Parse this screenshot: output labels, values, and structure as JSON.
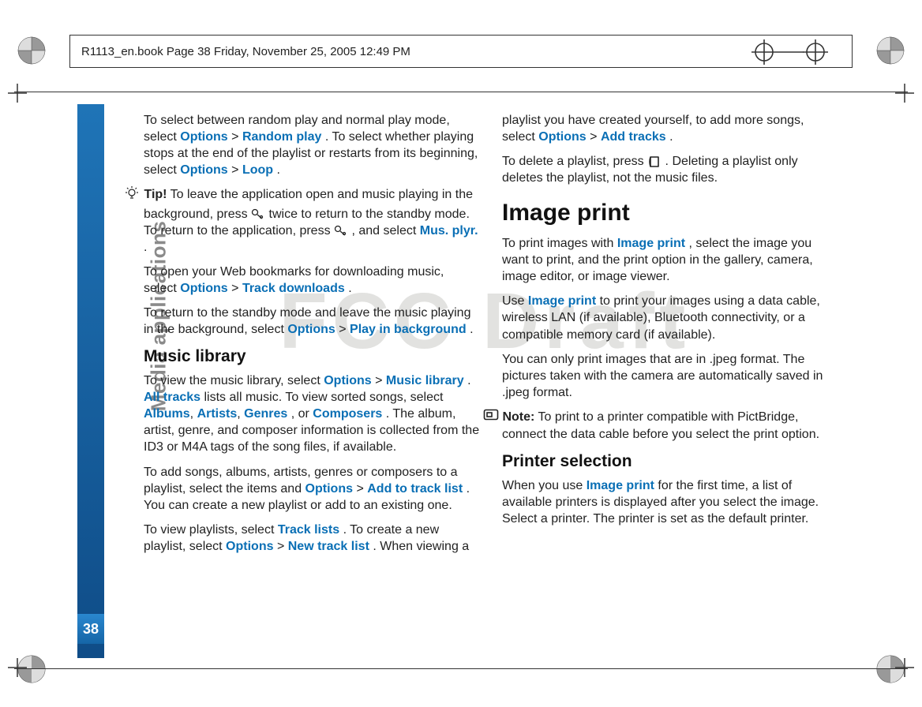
{
  "runningHead": "R1113_en.book  Page 38  Friday, November 25, 2005  12:49 PM",
  "sidebarTitle": "Media applications",
  "pageNumber": "38",
  "watermark": "FCC Draft",
  "col1": {
    "p1a": "To select between random play and normal play mode, select ",
    "opt": "Options",
    "gt": " > ",
    "p1b": "Random play",
    "p1c": ". To select whether playing stops at the end of the playlist or restarts from its beginning, select ",
    "p1d": "Loop",
    "p1e": ".",
    "tipLabel": "Tip!",
    "tipText1": " To leave the application open and music playing in the background, press ",
    "tipText2": " twice to return to the standby mode. To return to the application, press ",
    "tipText3": ", and select ",
    "tipMus": "Mus. plyr.",
    "tipText4": ".",
    "p2a": "To open your Web bookmarks for downloading music, select ",
    "p2b": "Track downloads",
    "p2c": ".",
    "p3a": "To return to the standby mode and leave the music playing in the background, select ",
    "p3b": "Play in background",
    "p3c": ".",
    "h3": "Music library",
    "p4a": "To view the music library, select ",
    "p4b": "Music library",
    "p4c": ". ",
    "allTracks": "All tracks",
    "p4d": " lists all music. To view sorted songs, select ",
    "albums": "Albums",
    "artists": "Artists",
    "genres": "Genres",
    "orWord": ", or ",
    "composers": "Composers",
    "p4e": ". The album, artist, genre, and composer information is collected from the ID3 or M4A tags of the song files, if available.",
    "p5a": "To add songs, albums, artists, genres or composers to a playlist, select the items and ",
    "p5b": "Add to track list",
    "p5c": ". You can create a new playlist or add to an existing one.",
    "p6a": "To view playlists, select ",
    "tracklists": "Track lists",
    "p6b": ". To create a new playlist, select ",
    "p6c": "New track list",
    "p6d": ". When viewing a"
  },
  "col2": {
    "p1a": "playlist you have created yourself, to add more songs, select ",
    "opt": "Options",
    "gt": " > ",
    "p1b": "Add tracks",
    "p1c": ".",
    "p2a": "To delete a playlist, press ",
    "p2b": ". Deleting a playlist only deletes the playlist, not the music files.",
    "h2": "Image print",
    "p3a": "To print images with ",
    "imgPrint": "Image print",
    "p3b": ", select the image you want to print, and the print option in the gallery, camera, image editor, or image viewer.",
    "p4a": "Use ",
    "p4b": " to print your images using a data cable, wireless LAN (if available), Bluetooth connectivity, or a compatible memory card (if available).",
    "p5": "You can only print images that are in .jpeg format. The pictures taken with the camera are automatically saved in .jpeg format.",
    "noteLabel": "Note:",
    "noteText": " To print to a printer compatible with PictBridge, connect the data cable before you select the print option.",
    "h3": "Printer selection",
    "p6a": "When you use ",
    "p6b": " for the first time, a list of available printers is displayed after you select the image. Select a printer. The printer is set as the default printer."
  }
}
